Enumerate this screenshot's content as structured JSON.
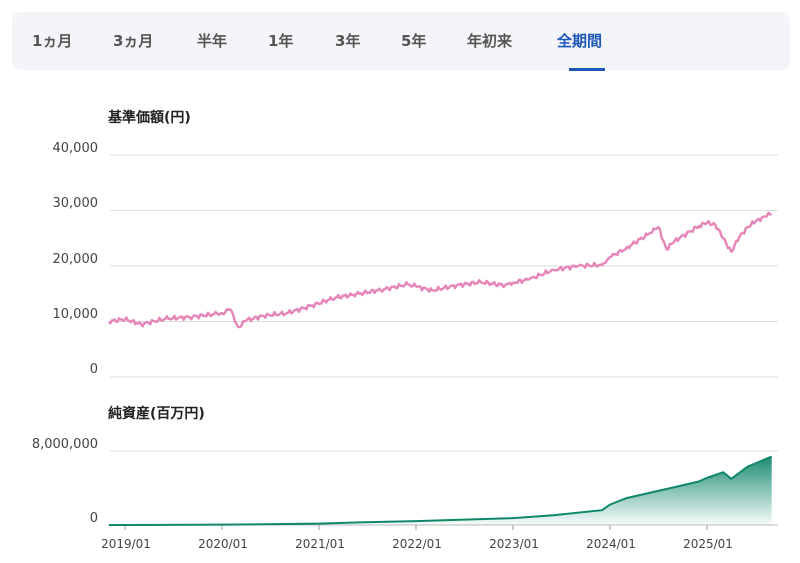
{
  "tabs": [
    {
      "label": "1ヵ月",
      "active": false
    },
    {
      "label": "3ヵ月",
      "active": false
    },
    {
      "label": "半年",
      "active": false
    },
    {
      "label": "1年",
      "active": false
    },
    {
      "label": "3年",
      "active": false
    },
    {
      "label": "5年",
      "active": false
    },
    {
      "label": "年初来",
      "active": false
    },
    {
      "label": "全期間",
      "active": true
    }
  ],
  "colors": {
    "nav_line": "#e585b8",
    "assets_line": "#11876a",
    "active_tab": "#1d55b8",
    "grid": "#dddddd"
  },
  "chart_data": [
    {
      "type": "line",
      "title": "基準価額(円)",
      "ylim": [
        0,
        40000
      ],
      "yticks": [
        "40,000",
        "30,000",
        "20,000",
        "10,000",
        "0"
      ],
      "x": [
        "2018/11",
        "2019/01",
        "2019/03",
        "2019/06",
        "2019/09",
        "2019/12",
        "2020/01",
        "2020/02",
        "2020/03",
        "2020/04",
        "2020/06",
        "2020/09",
        "2020/12",
        "2021/03",
        "2021/06",
        "2021/09",
        "2021/12",
        "2022/01",
        "2022/03",
        "2022/06",
        "2022/09",
        "2022/12",
        "2023/01",
        "2023/03",
        "2023/06",
        "2023/09",
        "2023/12",
        "2024/01",
        "2024/03",
        "2024/06",
        "2024/07",
        "2024/08",
        "2024/09",
        "2024/12",
        "2025/01",
        "2025/02",
        "2025/03",
        "2025/04",
        "2025/05",
        "2025/06",
        "2025/07",
        "2025/08",
        "2025/09"
      ],
      "values": [
        10000,
        10400,
        9500,
        10500,
        10800,
        11300,
        11500,
        12200,
        9000,
        10200,
        11000,
        11500,
        12800,
        14300,
        15000,
        15800,
        16700,
        16300,
        15600,
        16500,
        17100,
        16500,
        17000,
        17600,
        19300,
        20000,
        20200,
        21600,
        23200,
        26000,
        27000,
        23000,
        24500,
        27200,
        27800,
        27500,
        25000,
        22600,
        25200,
        27000,
        28000,
        28900,
        29400
      ]
    },
    {
      "type": "area",
      "title": "純資産(百万円)",
      "ylim": [
        0,
        8000000
      ],
      "yticks": [
        "8,000,000",
        "0"
      ],
      "x": [
        "2018/11",
        "2019/06",
        "2020/01",
        "2020/06",
        "2021/01",
        "2021/06",
        "2022/01",
        "2022/06",
        "2023/01",
        "2023/06",
        "2023/12",
        "2024/01",
        "2024/03",
        "2024/06",
        "2024/09",
        "2024/12",
        "2025/01",
        "2025/03",
        "2025/04",
        "2025/06",
        "2025/09"
      ],
      "values": [
        0,
        10000,
        40000,
        80000,
        150000,
        280000,
        420000,
        550000,
        750000,
        1050000,
        1600000,
        2200000,
        2900000,
        3500000,
        4100000,
        4700000,
        5100000,
        5700000,
        5000000,
        6300000,
        7400000
      ],
      "xticks": [
        "2019/01",
        "2020/01",
        "2021/01",
        "2022/01",
        "2023/01",
        "2024/01",
        "2025/01"
      ]
    }
  ]
}
